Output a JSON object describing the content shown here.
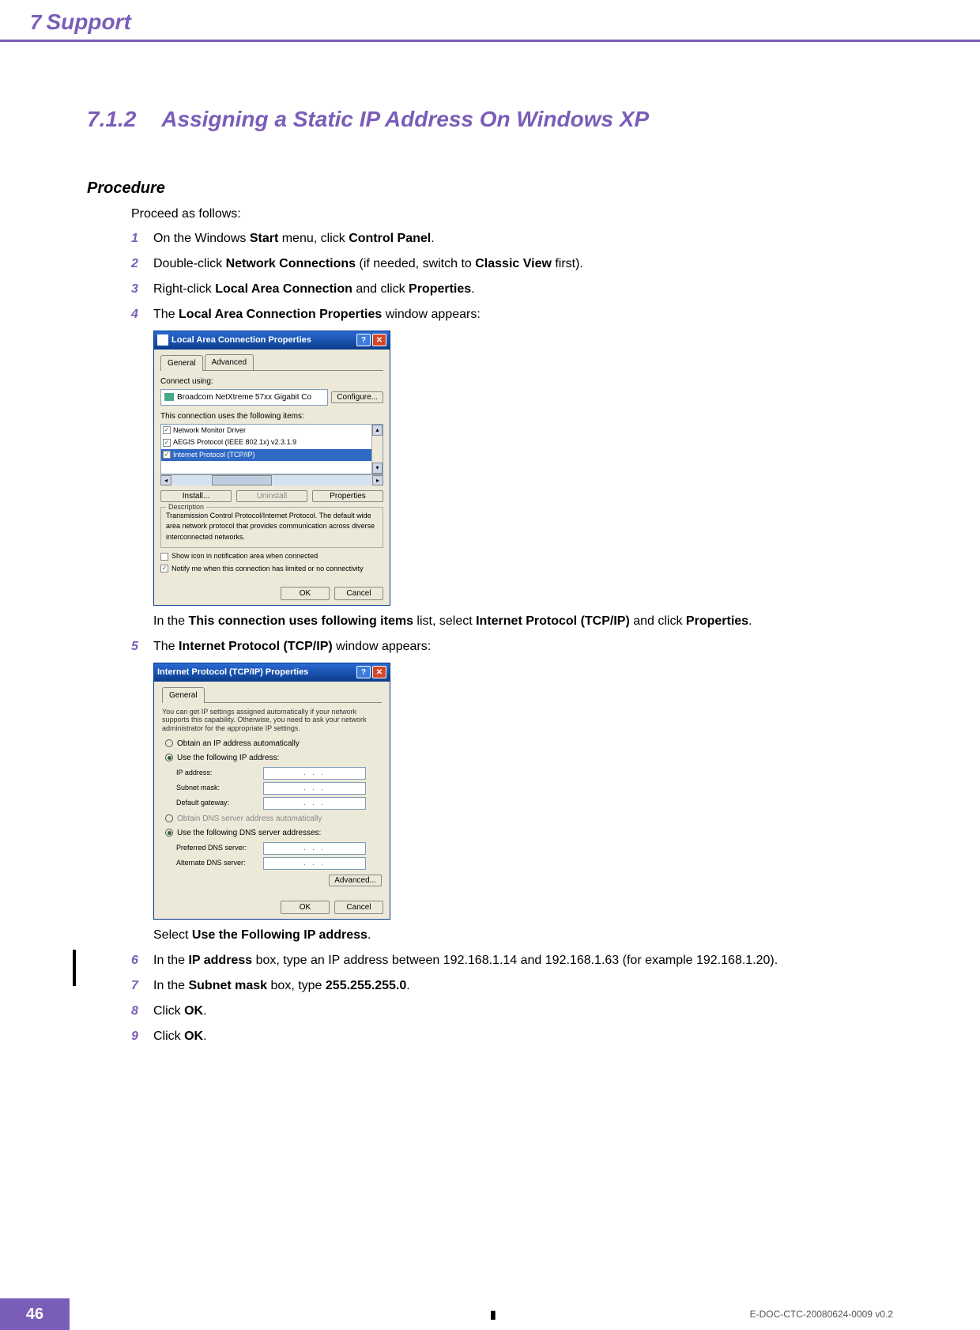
{
  "header": {
    "chapter_num": "7",
    "chapter_title": "Support"
  },
  "section": {
    "num": "7.1.2",
    "title": "Assigning a Static IP Address On Windows XP"
  },
  "procedure": {
    "heading": "Procedure",
    "intro": "Proceed as follows:",
    "steps": {
      "s1": {
        "num": "1",
        "pre": "On the Windows ",
        "b1": "Start",
        "mid": " menu, click ",
        "b2": "Control Panel",
        "post": "."
      },
      "s2": {
        "num": "2",
        "pre": "Double-click ",
        "b1": "Network Connections",
        "mid": " (if needed, switch to ",
        "b2": "Classic View",
        "post": " first)."
      },
      "s3": {
        "num": "3",
        "pre": "Right-click ",
        "b1": "Local Area Connection",
        "mid": " and click ",
        "b2": "Properties",
        "post": "."
      },
      "s4": {
        "num": "4",
        "pre": "The ",
        "b1": "Local Area Connection Properties",
        "post": " window appears:"
      },
      "s4b": {
        "pre": "In the ",
        "b1": "This connection uses following items",
        "mid": " list, select ",
        "b2": "Internet Protocol (TCP/IP)",
        "mid2": " and click ",
        "b3": "Properties",
        "post": "."
      },
      "s5": {
        "num": "5",
        "pre": "The ",
        "b1": "Internet Protocol (TCP/IP)",
        "post": " window appears:"
      },
      "s5b": {
        "pre": "Select ",
        "b1": "Use the Following IP address",
        "post": "."
      },
      "s6": {
        "num": "6",
        "pre": "In the ",
        "b1": "IP address",
        "post": " box, type an IP address between 192.168.1.14 and 192.168.1.63 (for example 192.168.1.20)."
      },
      "s7": {
        "num": "7",
        "pre": "In the ",
        "b1": "Subnet mask",
        "mid": " box, type ",
        "b2": "255.255.255.0",
        "post": "."
      },
      "s8": {
        "num": "8",
        "pre": "Click ",
        "b1": "OK",
        "post": "."
      },
      "s9": {
        "num": "9",
        "pre": "Click ",
        "b1": "OK",
        "post": "."
      }
    }
  },
  "dialog1": {
    "title": "Local Area Connection Properties",
    "tabs": {
      "general": "General",
      "advanced": "Advanced"
    },
    "connect_using": "Connect using:",
    "adapter": "Broadcom NetXtreme 57xx Gigabit Co",
    "configure": "Configure...",
    "items_label": "This connection uses the following items:",
    "items": {
      "i1": "Network Monitor Driver",
      "i2": "AEGIS Protocol (IEEE 802.1x) v2.3.1.9",
      "i3": "Internet Protocol (TCP/IP)"
    },
    "install": "Install...",
    "uninstall": "Uninstall",
    "properties": "Properties",
    "desc_legend": "Description",
    "desc_text": "Transmission Control Protocol/Internet Protocol. The default wide area network protocol that provides communication across diverse interconnected networks.",
    "chk_show": "Show icon in notification area when connected",
    "chk_notify": "Notify me when this connection has limited or no connectivity",
    "ok": "OK",
    "cancel": "Cancel"
  },
  "dialog2": {
    "title": "Internet Protocol (TCP/IP) Properties",
    "tab_general": "General",
    "para": "You can get IP settings assigned automatically if your network supports this capability. Otherwise, you need to ask your network administrator for the appropriate IP settings.",
    "radio_auto_ip": "Obtain an IP address automatically",
    "radio_use_ip": "Use the following IP address:",
    "ip_address": "IP address:",
    "subnet_mask": "Subnet mask:",
    "default_gw": "Default gateway:",
    "radio_auto_dns": "Obtain DNS server address automatically",
    "radio_use_dns": "Use the following DNS server addresses:",
    "pref_dns": "Preferred DNS server:",
    "alt_dns": "Alternate DNS server:",
    "advanced": "Advanced...",
    "ok": "OK",
    "cancel": "Cancel",
    "ip_placeholder": ".   .   ."
  },
  "footer": {
    "page": "46",
    "doc_id": "E-DOC-CTC-20080624-0009 v0.2"
  }
}
